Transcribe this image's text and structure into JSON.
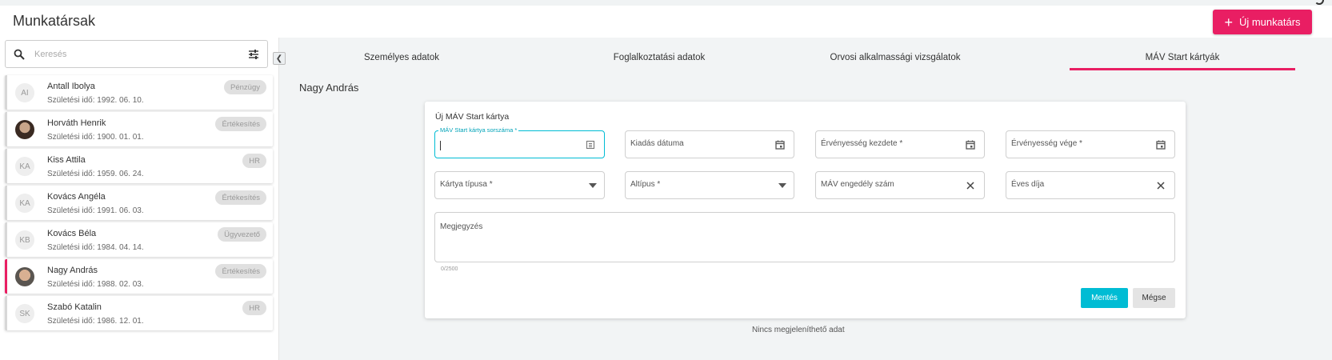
{
  "header": {
    "title": "Munkatársak",
    "new_button_label": "Új munkatárs"
  },
  "search": {
    "placeholder": "Keresés"
  },
  "employees": [
    {
      "initials": "AI",
      "name": "Antall Ibolya",
      "birth": "Születési idő: 1992. 06. 10.",
      "badge": "Pénzügy"
    },
    {
      "initials": "",
      "name": "Horváth Henrik",
      "birth": "Születési idő: 1900. 01. 01.",
      "badge": "Értékesítés"
    },
    {
      "initials": "KA",
      "name": "Kiss Attila",
      "birth": "Születési idő: 1959. 06. 24.",
      "badge": "HR"
    },
    {
      "initials": "KA",
      "name": "Kovács Angéla",
      "birth": "Születési idő: 1991. 06. 03.",
      "badge": "Értékesítés"
    },
    {
      "initials": "KB",
      "name": "Kovács Béla",
      "birth": "Születési idő: 1984. 04. 14.",
      "badge": "Ügyvezető"
    },
    {
      "initials": "",
      "name": "Nagy András",
      "birth": "Születési idő: 1988. 02. 03.",
      "badge": "Értékesítés"
    },
    {
      "initials": "SK",
      "name": "Szabó Katalin",
      "birth": "Születési idő: 1986. 12. 01.",
      "badge": "HR"
    }
  ],
  "tabs": [
    {
      "label": "Személyes adatok"
    },
    {
      "label": "Foglalkoztatási adatok"
    },
    {
      "label": "Orvosi alkalmassági vizsgálatok"
    },
    {
      "label": "MÁV Start kártyák"
    }
  ],
  "selected_person": "Nagy András",
  "form": {
    "title": "Új MÁV Start kártya",
    "card_number_label": "MÁV Start kártya sorszáma *",
    "issue_date_label": "Kiadás dátuma",
    "valid_from_label": "Érvényesség kezdete *",
    "valid_to_label": "Érvényesség vége *",
    "card_type_label": "Kártya típusa *",
    "subtype_label": "Altípus *",
    "permit_number_label": "MÁV engedély szám",
    "annual_fee_label": "Éves díja",
    "note_label": "Megjegyzés",
    "note_counter": "0/2500",
    "save_label": "Mentés",
    "cancel_label": "Mégse"
  },
  "empty_message": "Nincs megjeleníthető adat",
  "colors": {
    "accent": "#e91e63",
    "primary": "#00bcd4"
  }
}
